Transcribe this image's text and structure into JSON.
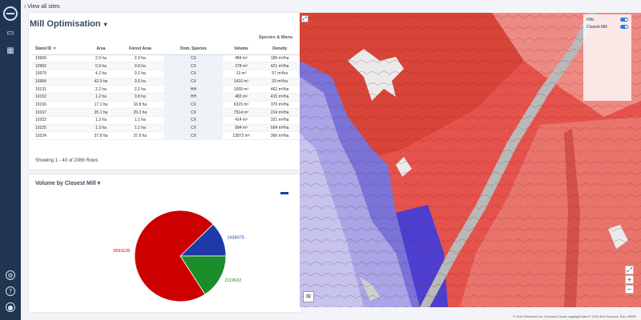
{
  "nav": {
    "back_label": "View all sites",
    "icons": [
      "globe-icon",
      "map-icon",
      "grid-icon",
      "settings-icon",
      "help-icon",
      "user-icon"
    ]
  },
  "header": {
    "title": "Mill Optimisation",
    "caret": "▾"
  },
  "table": {
    "group_header": "Species & Manu",
    "columns": [
      "Stand ID",
      "Area",
      "Forest Area",
      "Dom. Species",
      "Volume",
      "Density"
    ],
    "rows": [
      [
        "10958",
        "2.5 ha",
        "2.3 ha",
        "CX",
        "484 m³",
        "189 m³/ha"
      ],
      [
        "10962",
        "0.9 ha",
        "0.9 ha",
        "CX",
        "378 m³",
        "421 m³/ha"
      ],
      [
        "10979",
        "4.2 ha",
        "0.1 ha",
        "CX",
        "13 m³",
        "57 m³/ha"
      ],
      [
        "10984",
        "42.9 ha",
        "3.6 ha",
        "CX",
        "1416 m³",
        "33 m³/ha"
      ],
      [
        "10131",
        "2.2 ha",
        "2.2 ha",
        "HH",
        "1009 m³",
        "462 m³/ha"
      ],
      [
        "10152",
        "1.2 ha",
        "0.8 ha",
        "HH",
        "483 m³",
        "415 m³/ha"
      ],
      [
        "10156",
        "17.1 ha",
        "16.8 ha",
        "CX",
        "6315 m³",
        "370 m³/ha"
      ],
      [
        "10167",
        "35.1 ha",
        "25.3 ha",
        "CX",
        "7514 m³",
        "214 m³/ha"
      ],
      [
        "10203",
        "1.3 ha",
        "1.1 ha",
        "CX",
        "414 m³",
        "321 m³/ha"
      ],
      [
        "10225",
        "1.3 ha",
        "1.1 ha",
        "CX",
        "994 m³",
        "664 m³/ha"
      ],
      [
        "10224",
        "37.8 ha",
        "37.8 ha",
        "CX",
        "13872 m³",
        "366 m³/ha"
      ]
    ],
    "rows_info": "Showing 1 - 40 of 2086 Rows"
  },
  "pie_card": {
    "title": "Volume by Closest Mill",
    "caret": "▾"
  },
  "chart_data": {
    "type": "pie",
    "title": "",
    "slices": [
      {
        "label": "9591135",
        "value": 9591135,
        "color": "#cc0000"
      },
      {
        "label": "1634075",
        "value": 1634075,
        "color": "#1f3aa8"
      },
      {
        "label": "2119632",
        "value": 2119632,
        "color": "#1a8c2a"
      }
    ],
    "legend_position": "top-right"
  },
  "map": {
    "layers": [
      {
        "label": "Hills",
        "on": true
      },
      {
        "label": "Closest Mill",
        "on": true
      }
    ],
    "expand_icon": "expand-icon",
    "zoom_in": "+",
    "zoom_out": "−",
    "layers_icon": "layers-icon",
    "credit": "© 2021 Resident Ltd. Contains Crown copyright data © 2015 Esri Sources, Esri, HERE"
  }
}
